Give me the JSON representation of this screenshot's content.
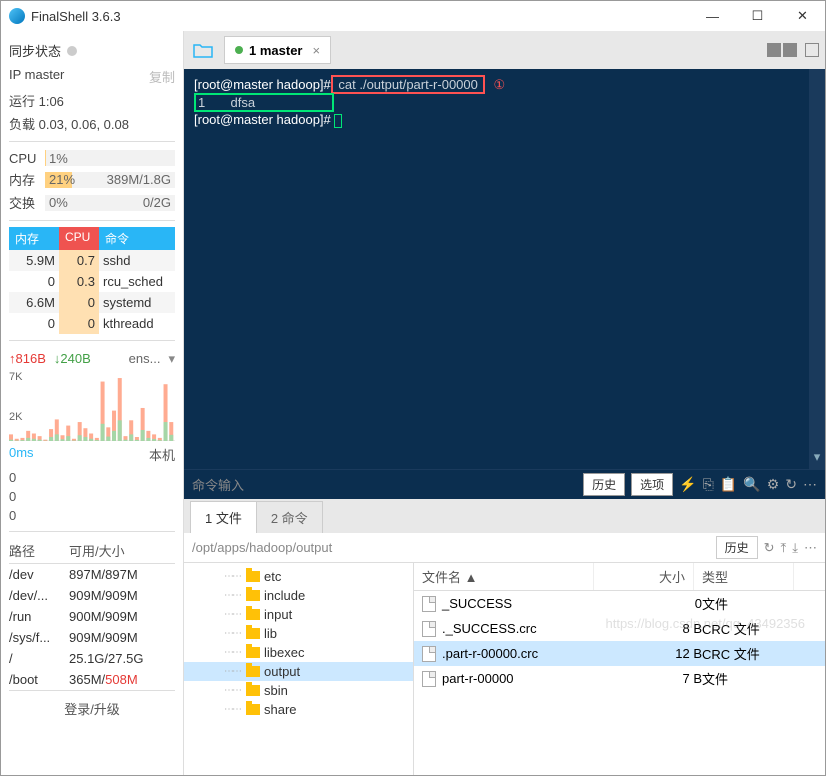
{
  "window": {
    "title": "FinalShell 3.6.3"
  },
  "sidebar": {
    "sync_label": "同步状态",
    "ip_label": "IP master",
    "copy": "复制",
    "uptime": "运行 1:06",
    "load": "负载 0.03, 0.06, 0.08",
    "cpu": {
      "label": "CPU",
      "pct": "1%"
    },
    "mem": {
      "label": "内存",
      "pct": "21%",
      "detail": "389M/1.8G"
    },
    "swap": {
      "label": "交换",
      "pct": "0%",
      "detail": "0/2G"
    },
    "proc_hdr": {
      "mem": "内存",
      "cpu": "CPU",
      "cmd": "命令"
    },
    "procs": [
      {
        "mem": "5.9M",
        "cpu": "0.7",
        "cmd": "sshd"
      },
      {
        "mem": "0",
        "cpu": "0.3",
        "cmd": "rcu_sched"
      },
      {
        "mem": "6.6M",
        "cpu": "0",
        "cmd": "systemd"
      },
      {
        "mem": "0",
        "cpu": "0",
        "cmd": "kthreadd"
      }
    ],
    "net": {
      "up": "↑816B",
      "down": "↓240B",
      "if": "ens..."
    },
    "y7k": "7K",
    "y2k": "2K",
    "ping": "0ms",
    "host": "本机",
    "s1": "0",
    "s2": "0",
    "s3": "0",
    "disk_hdr": {
      "path": "路径",
      "size": "可用/大小"
    },
    "disks": [
      {
        "path": "/dev",
        "size": "897M/897M"
      },
      {
        "path": "/dev/...",
        "size": "909M/909M"
      },
      {
        "path": "/run",
        "size": "900M/909M"
      },
      {
        "path": "/sys/f...",
        "size": "909M/909M"
      },
      {
        "path": "/",
        "size": "25.1G/27.5G"
      },
      {
        "path": "/boot",
        "size_a": "365M/",
        "size_b": "508M"
      }
    ],
    "login": "登录/升级"
  },
  "tabs": {
    "main": "1 master"
  },
  "terminal": {
    "line1_prompt": "[root@master hadoop]#",
    "line1_cmd": " cat ./output/part-r-00000 ",
    "circ": "①",
    "line2": "1       dfsa",
    "line3_prompt": "[root@master hadoop]# ",
    "cmd_placeholder": "命令输入",
    "history": "历史",
    "options": "选项"
  },
  "filetabs": {
    "t1": "1 文件",
    "t2": "2 命令"
  },
  "path": "/opt/apps/hadoop/output",
  "path_history": "历史",
  "tree": [
    "etc",
    "include",
    "input",
    "lib",
    "libexec",
    "output",
    "sbin",
    "share"
  ],
  "files": {
    "hdr": {
      "name": "文件名 ▲",
      "size": "大小",
      "type": "类型"
    },
    "rows": [
      {
        "name": "_SUCCESS",
        "size": "0",
        "type": "文件"
      },
      {
        "name": "._SUCCESS.crc",
        "size": "8 B",
        "type": "CRC 文件"
      },
      {
        "name": ".part-r-00000.crc",
        "size": "12 B",
        "type": "CRC 文件"
      },
      {
        "name": "part-r-00000",
        "size": "7 B",
        "type": "文件"
      }
    ]
  },
  "chart_data": {
    "type": "bar",
    "title": "",
    "xlabel": "",
    "ylabel": "",
    "ylim": [
      0,
      8000
    ],
    "series": [
      {
        "name": "up",
        "values": [
          800,
          300,
          400,
          1200,
          900,
          600,
          200,
          1400,
          2500,
          700,
          1800,
          300,
          2200,
          1500,
          900,
          400,
          6800,
          1600,
          3500,
          7200,
          600,
          2400,
          500,
          3800,
          1200,
          800,
          400,
          6500,
          2200
        ]
      },
      {
        "name": "down",
        "values": [
          200,
          100,
          150,
          400,
          300,
          200,
          80,
          500,
          800,
          250,
          600,
          100,
          700,
          500,
          300,
          150,
          2000,
          550,
          1200,
          2400,
          200,
          800,
          180,
          1300,
          400,
          280,
          140,
          2200,
          750
        ]
      }
    ]
  },
  "watermark": "https://blog.csdn.net/qq_43492356"
}
